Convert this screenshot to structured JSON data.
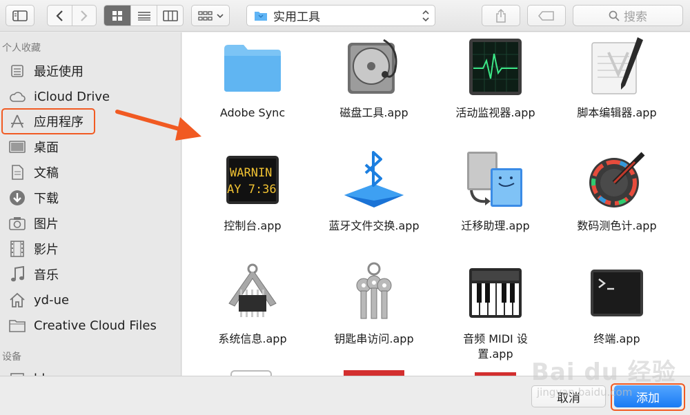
{
  "toolbar": {
    "path_label": "实用工具",
    "search_placeholder": "搜索"
  },
  "sidebar": {
    "favorites_header": "个人收藏",
    "devices_header": "设备",
    "items": [
      {
        "label": "最近使用",
        "icon": "recent-icon"
      },
      {
        "label": "iCloud Drive",
        "icon": "cloud-icon"
      },
      {
        "label": "应用程序",
        "icon": "applications-icon"
      },
      {
        "label": "桌面",
        "icon": "desktop-icon"
      },
      {
        "label": "文稿",
        "icon": "documents-icon"
      },
      {
        "label": "下载",
        "icon": "downloads-icon"
      },
      {
        "label": "图片",
        "icon": "pictures-icon"
      },
      {
        "label": "影片",
        "icon": "movies-icon"
      },
      {
        "label": "音乐",
        "icon": "music-icon"
      },
      {
        "label": "yd-ue",
        "icon": "home-icon"
      },
      {
        "label": "Creative Cloud Files",
        "icon": "folder-icon"
      }
    ],
    "device_partial_label": "bb"
  },
  "files": [
    {
      "name": "Adobe Sync",
      "icon": "blue-folder-icon"
    },
    {
      "name": "磁盘工具.app",
      "icon": "disk-utility-icon"
    },
    {
      "name": "活动监视器.app",
      "icon": "activity-monitor-icon"
    },
    {
      "name": "脚本编辑器.app",
      "icon": "script-editor-icon"
    },
    {
      "name": "控制台.app",
      "icon": "console-icon"
    },
    {
      "name": "蓝牙文件交换.app",
      "icon": "bluetooth-icon"
    },
    {
      "name": "迁移助理.app",
      "icon": "migration-assistant-icon"
    },
    {
      "name": "数码测色计.app",
      "icon": "color-meter-icon"
    },
    {
      "name": "系统信息.app",
      "icon": "system-information-icon"
    },
    {
      "name": "钥匙串访问.app",
      "icon": "keychain-icon"
    },
    {
      "name": "音频 MIDI 设置.app",
      "name_line1": "音频 MIDI 设",
      "name_line2": "置.app",
      "icon": "audio-midi-icon"
    },
    {
      "name": "终端.app",
      "icon": "terminal-icon"
    }
  ],
  "console_text": {
    "line1": "WARNIN",
    "line2": "AY 7:36"
  },
  "buttons": {
    "cancel": "取消",
    "add": "添加"
  },
  "watermark": {
    "brand": "Bai du 经验",
    "url": "jingyan.baidu.com"
  },
  "colors": {
    "accent": "#1a7bf4",
    "highlight": "#f15a22"
  }
}
